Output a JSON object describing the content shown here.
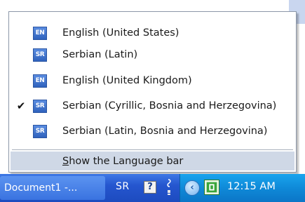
{
  "language_menu": {
    "items": [
      {
        "badge": "EN",
        "label": "English (United States)",
        "checked": false
      },
      {
        "badge": "SR",
        "label": "Serbian (Latin)",
        "checked": false
      },
      {
        "badge": "EN",
        "label": "English (United Kingdom)",
        "checked": false
      },
      {
        "badge": "SR",
        "label": "Serbian (Cyrillic, Bosnia and Herzegovina)",
        "checked": true,
        "check_mark": "✔"
      },
      {
        "badge": "SR",
        "label": "Serbian (Latin, Bosnia and Herzegovina)",
        "checked": false
      }
    ],
    "show_language_bar_label": "Show the Language bar"
  },
  "taskbar": {
    "task_button_label": "Document1 -...",
    "language_indicator": "SR",
    "help_icon_glyph": "?",
    "tray": {
      "chevron_glyph": "‹",
      "clock": "12:15 AM"
    }
  },
  "colors": {
    "taskbar_blue": "#2556cf",
    "systray_blue": "#0f8ad8",
    "badge_blue": "#3a6fc9",
    "menu_highlight": "#cfd8e6"
  }
}
